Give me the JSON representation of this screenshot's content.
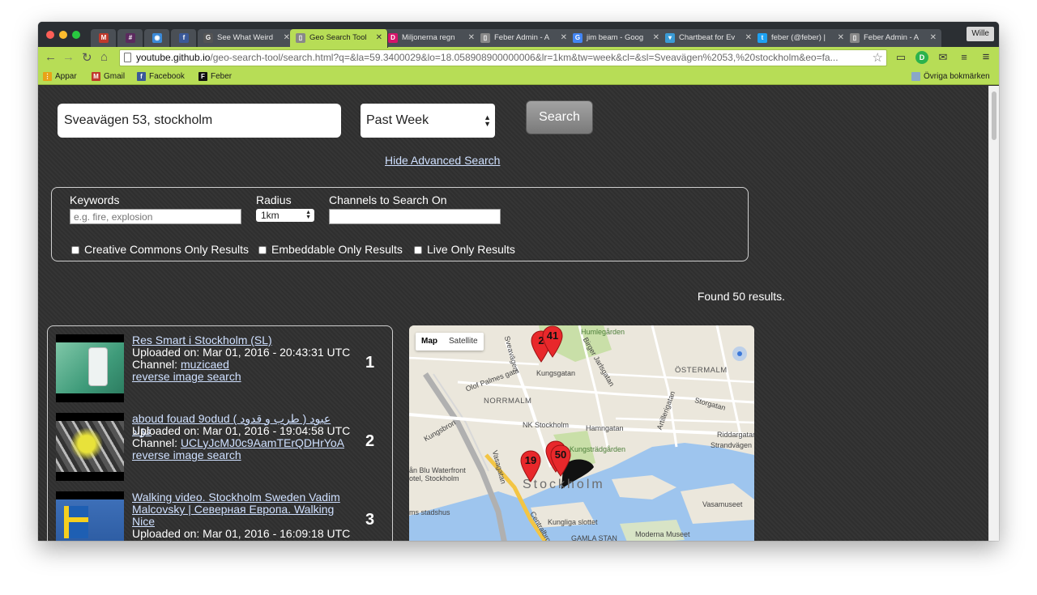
{
  "browser": {
    "tabs": [
      {
        "label": "",
        "icon": "gmail-icon",
        "color": "#c0392b",
        "glyph": "M"
      },
      {
        "label": "",
        "icon": "slack-icon",
        "color": "#5b2a5e",
        "glyph": "#"
      },
      {
        "label": "",
        "icon": "chrome-extension-icon",
        "color": "#3b8ad8",
        "glyph": "◉"
      },
      {
        "label": "",
        "icon": "facebook-icon",
        "color": "#3b5998",
        "glyph": "f"
      },
      {
        "label": "See What Weird",
        "icon": "g-icon",
        "color": "#555555",
        "glyph": "G"
      },
      {
        "label": "Geo Search Tool",
        "icon": "document-icon",
        "color": "#888888",
        "glyph": "▯"
      },
      {
        "label": "Miljonerna regn",
        "icon": "d-icon",
        "color": "#d6136a",
        "glyph": "D"
      },
      {
        "label": "Feber Admin - A",
        "icon": "document-icon",
        "color": "#888888",
        "glyph": "▯"
      },
      {
        "label": "jim beam - Goog",
        "icon": "google-icon",
        "color": "#4285f4",
        "glyph": "G"
      },
      {
        "label": "Chartbeat for Ev",
        "icon": "chartbeat-icon",
        "color": "#3a9bd5",
        "glyph": "▾"
      },
      {
        "label": "feber (@feber) |",
        "icon": "twitter-icon",
        "color": "#1da1f2",
        "glyph": "t"
      },
      {
        "label": "Feber Admin - A",
        "icon": "document-icon",
        "color": "#888888",
        "glyph": "▯"
      }
    ],
    "profile_name": "Wille",
    "url_host": "youtube.github.io",
    "url_rest": "/geo-search-tool/search.html?q=&la=59.3400029&lo=18.058908900000006&lr=1km&tw=week&cl=&sl=Sveavägen%2053,%20stockholm&eo=fa...",
    "bookmarks": [
      {
        "label": "Appar",
        "icon": "apps-icon",
        "color": "#e8a317",
        "glyph": "⋮"
      },
      {
        "label": "Gmail",
        "icon": "gmail-icon",
        "color": "#c0392b",
        "glyph": "M"
      },
      {
        "label": "Facebook",
        "icon": "facebook-icon",
        "color": "#3b5998",
        "glyph": "f"
      },
      {
        "label": "Feber",
        "icon": "feber-icon",
        "color": "#111111",
        "glyph": "F"
      }
    ],
    "other_bookmarks": "Övriga bokmärken"
  },
  "search": {
    "location_value": "Sveavägen 53, stockholm",
    "time_selected": "Past Week",
    "button_label": "Search",
    "hide_advanced_label": "Hide Advanced Search"
  },
  "advanced": {
    "keywords_label": "Keywords",
    "keywords_placeholder": "e.g. fire, explosion",
    "radius_label": "Radius",
    "radius_selected": "1km",
    "channels_label": "Channels to Search On",
    "channels_value": "",
    "cc_label": "Creative Commons Only Results",
    "embeddable_label": "Embeddable Only Results",
    "live_label": "Live Only Results"
  },
  "results_summary": "Found 50 results.",
  "results": [
    {
      "number": "1",
      "title": "Res Smart i Stockholm (SL)",
      "uploaded": "Uploaded on: Mar 01, 2016 - 20:43:31 UTC",
      "channel_prefix": "Channel:",
      "channel": "muzicaed",
      "reverse_link": "reverse image search"
    },
    {
      "number": "2",
      "title": "aboud fouad 9odud ( طرب و قدود ) عبود فؤاد",
      "uploaded": "Uploaded on: Mar 01, 2016 - 19:04:58 UTC",
      "channel_prefix": "Channel:",
      "channel": "UCLyJcMJ0c9AamTErQDHrYoA",
      "reverse_link": "reverse image search"
    },
    {
      "number": "3",
      "title": "Walking video. Stockholm Sweden Vadim Malcovsky | Северная Европа. Walking Nice",
      "uploaded": "Uploaded on: Mar 01, 2016 - 16:09:18 UTC",
      "channel_prefix": "",
      "channel": "",
      "reverse_link": ""
    }
  ],
  "map": {
    "type_map": "Map",
    "type_satellite": "Satellite",
    "labels": {
      "humlegarden": "Humlegården",
      "ostermalm": "ÖSTERMALM",
      "norrmalm": "NORRMALM",
      "kungsgatan": "Kungsgatan",
      "olof_palmes": "Olof Palmes gata",
      "nk": "NK Stockholm",
      "hamngatan": "Hamngatan",
      "kungstradgarden": "Kungsträdgården",
      "storgatan": "Storgatan",
      "riddargatan": "Riddargatan",
      "strandvagen": "Strandvägen",
      "kungsbron": "Kungsbron",
      "artillerigatan": "Artillerigatan",
      "birger": "Birger Jarlsgatan",
      "sveavagen": "Sveavägen",
      "vasagatan": "Vasagatan",
      "waterfront": "ån Blu Waterfront",
      "hotel": "otel, Stockholm",
      "stadshus": "ms stadshus",
      "stockholm": "Stockholm",
      "slottet": "Kungliga slottet",
      "gamla": "GAMLA STAN",
      "moderna": "Moderna Museet",
      "vasamuseet": "Vasamuseet",
      "centralbron": "Centralbron"
    },
    "markers": [
      "2",
      "41",
      "19",
      "50"
    ]
  }
}
